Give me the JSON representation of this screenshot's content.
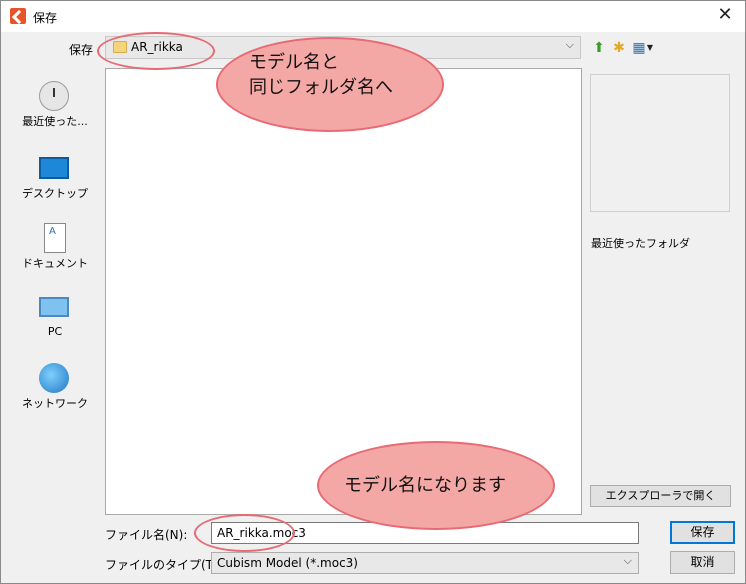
{
  "window": {
    "title": "保存"
  },
  "toolbar": {
    "save_label": "保存",
    "location": "AR_rikka",
    "up_icon": "up-folder-icon",
    "newfolder_icon": "new-folder-icon",
    "view_icon": "view-menu-icon"
  },
  "places": [
    {
      "label": "最近使った...",
      "icon": "recent-places-icon"
    },
    {
      "label": "デスクトップ",
      "icon": "desktop-icon"
    },
    {
      "label": "ドキュメント",
      "icon": "documents-icon"
    },
    {
      "label": "PC",
      "icon": "pc-icon"
    },
    {
      "label": "ネットワーク",
      "icon": "network-icon"
    }
  ],
  "preview": {
    "recent_folder_label": "最近使ったフォルダ",
    "explorer_button": "エクスプローラで開く"
  },
  "form": {
    "filename_label": "ファイル名(N):",
    "filename_value": "AR_rikka.moc3",
    "filetype_label": "ファイルのタイプ(T):",
    "filetype_value": "Cubism Model (*.moc3)"
  },
  "buttons": {
    "save": "保存",
    "cancel": "取消"
  },
  "annotations": {
    "bubble1_line1": "モデル名と",
    "bubble1_line2": "同じフォルダ名へ",
    "bubble2": "モデル名になります",
    "accent_color": "#e86a74",
    "bubble_fill": "#f4a8a6"
  }
}
